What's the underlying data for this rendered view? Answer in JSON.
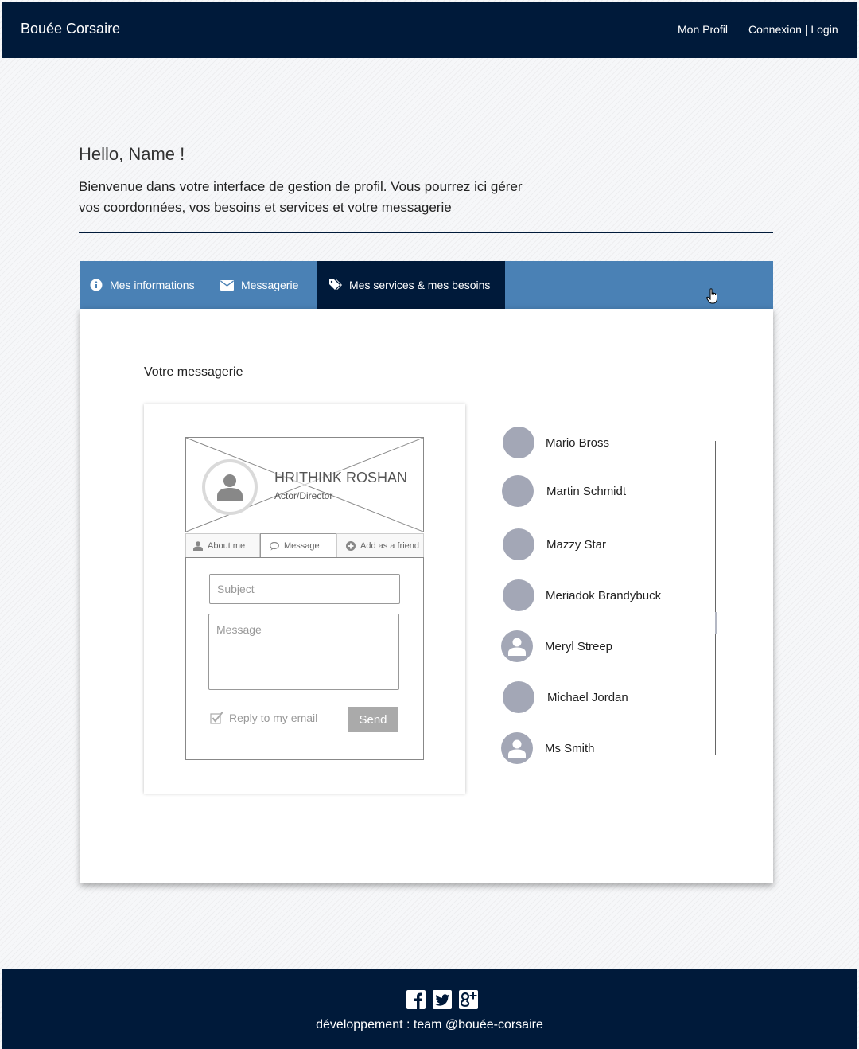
{
  "navbar": {
    "brand": "Bouée Corsaire",
    "links": [
      {
        "label": "Mon Profil"
      },
      {
        "label": "Connexion | Login"
      }
    ]
  },
  "header": {
    "greeting": "Hello, Name !",
    "intro_line1": "Bienvenue dans votre interface de gestion de profil. Vous pourrez ici gérer",
    "intro_line2": "vos coordonnées, vos besoins et services et votre messagerie"
  },
  "tabs": [
    {
      "label": "Mes informations",
      "icon": "info-icon"
    },
    {
      "label": "Messagerie",
      "icon": "envelope-icon"
    },
    {
      "label": "Mes services & mes besoins",
      "icon": "tags-icon",
      "active": true
    }
  ],
  "panel": {
    "title": "Votre messagerie"
  },
  "profile_card": {
    "name": "HRITHINK ROSHAN",
    "role": "Actor/Director",
    "tabs": [
      {
        "label": "About me",
        "icon": "user-icon"
      },
      {
        "label": "Message",
        "icon": "chat-icon"
      },
      {
        "label": "Add as a friend",
        "icon": "plus-circle-icon"
      }
    ],
    "subject_placeholder": "Subject",
    "message_placeholder": "Message",
    "reply_label": "Reply to my email",
    "reply_checked": true,
    "send_label": "Send"
  },
  "contacts": [
    {
      "name": "Mario Bross",
      "has_photo_icon": false
    },
    {
      "name": "Martin Schmidt",
      "has_photo_icon": false
    },
    {
      "name": "Mazzy Star",
      "has_photo_icon": false
    },
    {
      "name": "Meriadok Brandybuck",
      "has_photo_icon": false
    },
    {
      "name": "Meryl Streep",
      "has_photo_icon": true
    },
    {
      "name": "Michael Jordan",
      "has_photo_icon": false
    },
    {
      "name": "Ms Smith",
      "has_photo_icon": true
    }
  ],
  "footer": {
    "socials": [
      "facebook-icon",
      "twitter-icon",
      "google-plus-icon"
    ],
    "text": "développement : team @bouée-corsaire"
  },
  "colors": {
    "navy": "#001a3a",
    "tab_blue": "#4a81b5",
    "avatar_grey": "#a3a7b6"
  }
}
